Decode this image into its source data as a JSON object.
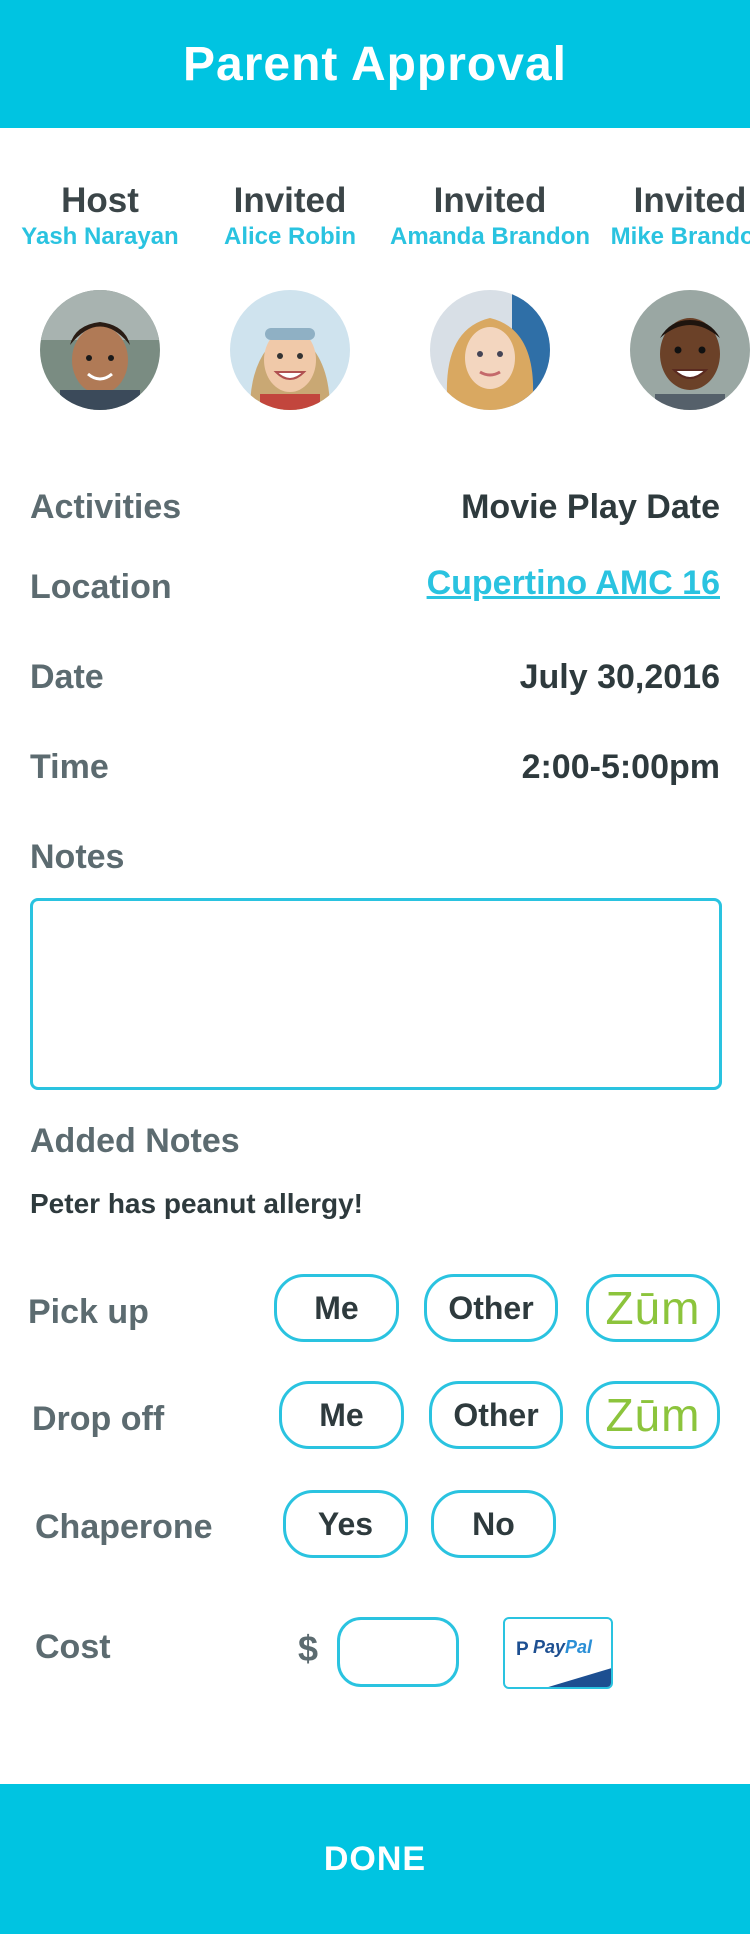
{
  "header": {
    "title": "Parent Approval"
  },
  "participants": [
    {
      "role": "Host",
      "name": "Yash Narayan"
    },
    {
      "role": "Invited",
      "name": "Alice Robin"
    },
    {
      "role": "Invited",
      "name": "Amanda Brandon"
    },
    {
      "role": "Invited",
      "name": "Mike Brandon"
    }
  ],
  "details": {
    "activities": {
      "label": "Activities",
      "value": "Movie Play Date"
    },
    "location": {
      "label": "Location",
      "value": "Cupertino AMC 16"
    },
    "date": {
      "label": "Date",
      "value": "July 30,2016"
    },
    "time": {
      "label": "Time",
      "value": "2:00-5:00pm"
    }
  },
  "notes": {
    "label": "Notes",
    "value": ""
  },
  "added_notes": {
    "label": "Added Notes",
    "text": "Peter has peanut allergy!"
  },
  "pickup": {
    "label": "Pick up",
    "me": "Me",
    "other": "Other",
    "zum": "Zūm"
  },
  "dropoff": {
    "label": "Drop off",
    "me": "Me",
    "other": "Other",
    "zum": "Zūm"
  },
  "chaperone": {
    "label": "Chaperone",
    "yes": "Yes",
    "no": "No"
  },
  "cost": {
    "label": "Cost",
    "currency": "$",
    "value": "",
    "paypal_pay": "Pay",
    "paypal_pal": "Pal"
  },
  "done_label": "DONE",
  "colors": {
    "accent": "#00c4e1",
    "link": "#2ac3e0",
    "zum": "#8cc43c"
  }
}
